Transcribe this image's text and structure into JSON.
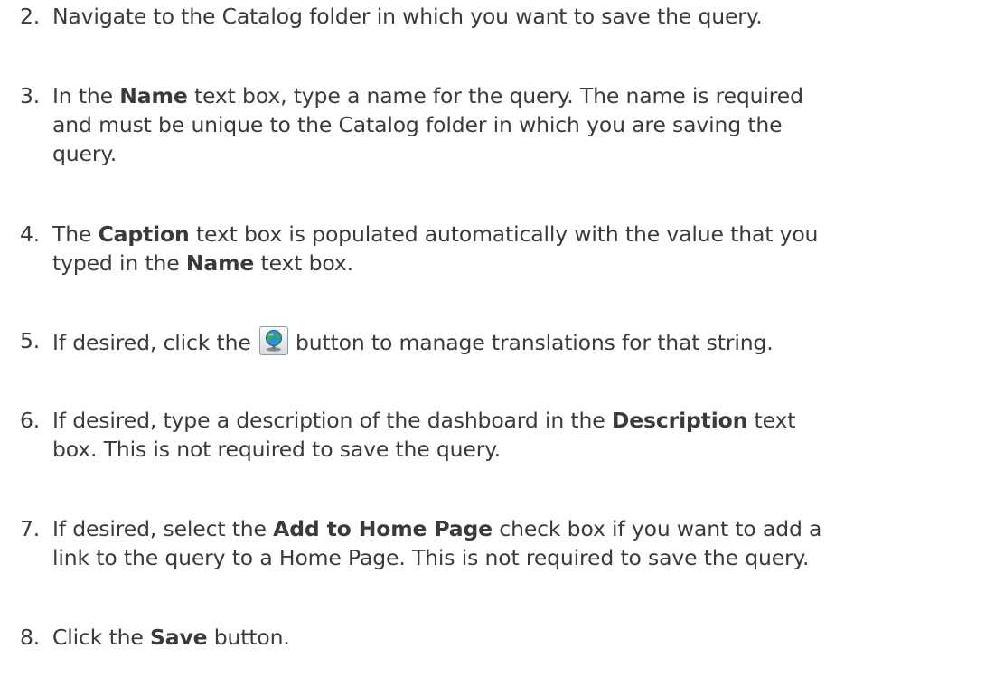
{
  "steps": [
    {
      "number": "2.",
      "parts": [
        "Navigate to the Catalog folder in which you want to save the query."
      ]
    },
    {
      "number": "3.",
      "parts": [
        "In the ",
        "Name",
        " text box, type a name for the query. The name is required",
        "and must be unique to the Catalog folder in which you are saving the",
        "query."
      ]
    },
    {
      "number": "4.",
      "parts": [
        "The ",
        "Caption",
        " text box is populated automatically with the value that you",
        "typed in the ",
        "Name",
        " text box."
      ]
    },
    {
      "number": "5.",
      "parts": [
        "If desired, click the ",
        "button to manage translations for that string."
      ],
      "icon": "globe-icon"
    },
    {
      "number": "6.",
      "parts": [
        "If desired, type a description of the dashboard in the ",
        "Description",
        " text",
        "box. This is not required to save the query."
      ]
    },
    {
      "number": "7.",
      "parts": [
        "If desired, select the ",
        "Add to Home Page",
        " check box if you want to add a",
        "link to the query to a Home Page. This is not required to save the query."
      ]
    },
    {
      "number": "8.",
      "parts": [
        "Click the ",
        "Save",
        " button."
      ]
    }
  ]
}
